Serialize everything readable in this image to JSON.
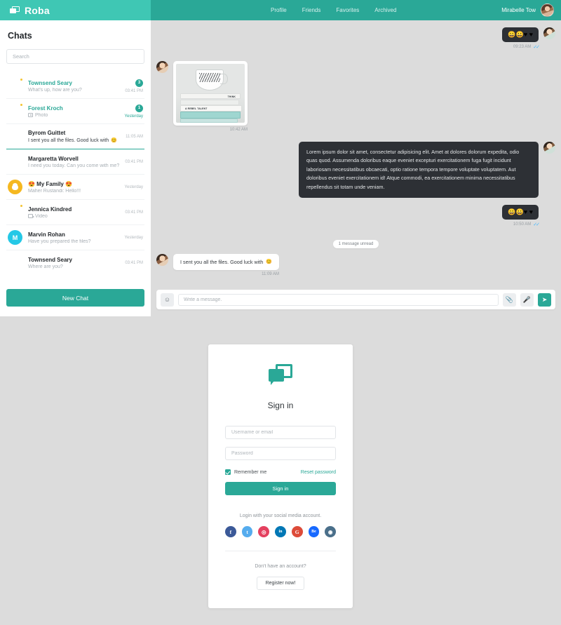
{
  "brand": {
    "name": "Roba",
    "icon": "chat-logo-icon"
  },
  "nav": {
    "links": [
      "Profile",
      "Friends",
      "Favorites",
      "Archived"
    ],
    "user_name": "Mirabelle Tow"
  },
  "sidebar": {
    "title": "Chats",
    "search_placeholder": "Search",
    "new_chat_label": "New Chat",
    "chats": [
      {
        "name": "Townsend Seary",
        "preview": "What's up, how are you?",
        "time": "03:41 PM",
        "badge": "3",
        "unread": true,
        "online": true,
        "icon": "",
        "avatar": "a1"
      },
      {
        "name": "Forest Kroch",
        "preview": "Photo",
        "time": "Yesterday",
        "badge": "1",
        "unread": true,
        "online": true,
        "icon": "camera-icon",
        "avatar": "a2"
      },
      {
        "name": "Byrom Guittet",
        "preview": "I sent you all the files. Good luck with",
        "preview_emoji": "😊",
        "time": "11:05 AM",
        "badge": "",
        "unread": false,
        "online": false,
        "icon": "",
        "avatar": "a3",
        "bold_preview": true
      },
      {
        "name": "Margaretta Worvell",
        "preview": "I need you today. Can you come with me?",
        "time": "03:41 PM",
        "badge": "",
        "unread": false,
        "online": false,
        "icon": "",
        "avatar": "a4"
      },
      {
        "name": "😍 My Family 😍",
        "preview": "Maher Rustandi: Hello!!!",
        "time": "Yesterday",
        "badge": "",
        "unread": false,
        "online": false,
        "icon": "",
        "avatar": "a5"
      },
      {
        "name": "Jennica Kindred",
        "preview": "Video",
        "time": "03:41 PM",
        "badge": "",
        "unread": false,
        "online": false,
        "icon": "video-icon",
        "avatar": "a6"
      },
      {
        "name": "Marvin Rohan",
        "preview": "Have you prepared the files?",
        "time": "Yesterday",
        "badge": "",
        "unread": false,
        "online": false,
        "icon": "",
        "avatar": "a7",
        "initial": "M"
      },
      {
        "name": "Townsend Seary",
        "preview": "Where are you?",
        "time": "03:41 PM",
        "badge": "",
        "unread": false,
        "online": false,
        "icon": "",
        "avatar": "a8"
      }
    ]
  },
  "conversation": {
    "messages": [
      {
        "type": "sticker",
        "side": "out",
        "emojis": "😀😀♥ ♥",
        "time": "09:23 AM",
        "ticks": "✓✓"
      },
      {
        "type": "photo",
        "side": "in",
        "time": "10:42 AM",
        "book_labels": [
          "A REBEL TALENT",
          "THINK"
        ]
      },
      {
        "type": "text",
        "side": "out",
        "text": "Lorem ipsum dolor sit amet, consectetur adipisicing elit. Amet at dolores dolorum expedita, odio quas quod. Assumenda doloribus eaque eveniet excepturi exercitationem fuga fugit incidunt laboriosam necessitatibus obcaecati, optio ratione tempora tempore voluptate voluptatem. Aut doloribus eveniet exercitationem id! Atque commodi, ea exercitationem minima necessitatibus repellendus sit totam unde veniam."
      },
      {
        "type": "sticker",
        "side": "out",
        "emojis": "😀😀♥ ♥",
        "time": "10:50 AM",
        "ticks": "✓✓"
      },
      {
        "type": "divider",
        "label": "1 message unread"
      },
      {
        "type": "text-white",
        "side": "in",
        "text": "I sent you all the files. Good luck with",
        "emoji": "😊",
        "time": "11:09 AM"
      }
    ],
    "composer": {
      "placeholder": "Write a message.",
      "emoji_button": "emoji-icon",
      "attach_button": "paperclip-icon",
      "mic_button": "microphone-icon",
      "send_button": "send-icon"
    }
  },
  "signin": {
    "title": "Sign in",
    "username_placeholder": "Username or email",
    "password_placeholder": "Password",
    "remember_label": "Remember me",
    "reset_label": "Reset password",
    "submit_label": "Sign in",
    "social_label": "Login with your social media account.",
    "socials": [
      {
        "name": "facebook",
        "glyph": "f",
        "color": "#3b5998"
      },
      {
        "name": "twitter",
        "glyph": "t",
        "color": "#55acee"
      },
      {
        "name": "instagram",
        "glyph": "◎",
        "color": "#e4405f"
      },
      {
        "name": "linkedin",
        "glyph": "in",
        "color": "#0077b5"
      },
      {
        "name": "google",
        "glyph": "G",
        "color": "#dd4b39"
      },
      {
        "name": "behance",
        "glyph": "Be",
        "color": "#1769ff"
      },
      {
        "name": "dribbble",
        "glyph": "◉",
        "color": "#4a6f8a"
      }
    ],
    "no_account_label": "Don't have an account?",
    "register_label": "Register now!"
  },
  "colors": {
    "brand_light": "#3fc7b4",
    "brand_dark": "#2aa897",
    "page_bg": "#dcdcdc",
    "bubble_dark": "#2d3035"
  }
}
